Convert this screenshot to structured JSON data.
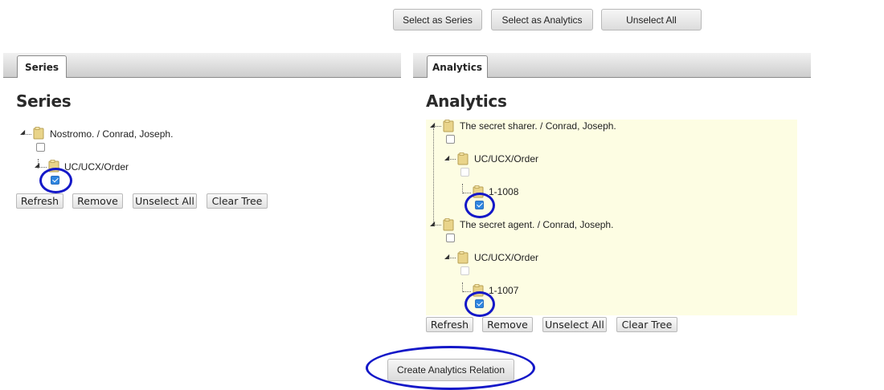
{
  "top_buttons": {
    "select_series": "Select as Series",
    "select_analytics": "Select as Analytics",
    "unselect_all": "Unselect All"
  },
  "series_panel": {
    "tab": "Series",
    "heading": "Series",
    "tree": {
      "root_label": "Nostromo. / Conrad, Joseph.",
      "child_label": "UC/UCX/Order",
      "child_checked": true
    },
    "buttons": {
      "refresh": "Refresh",
      "remove": "Remove",
      "unselect_all": "Unselect All",
      "clear_tree": "Clear Tree"
    }
  },
  "analytics_panel": {
    "tab": "Analytics",
    "heading": "Analytics",
    "tree": [
      {
        "root_label": "The secret sharer. / Conrad, Joseph.",
        "mid_label": "UC/UCX/Order",
        "leaf_label": "1-1008",
        "leaf_checked": true
      },
      {
        "root_label": "The secret agent. / Conrad, Joseph.",
        "mid_label": "UC/UCX/Order",
        "leaf_label": "1-1007",
        "leaf_checked": true
      }
    ],
    "buttons": {
      "refresh": "Refresh",
      "remove": "Remove",
      "unselect_all": "Unselect All",
      "clear_tree": "Clear Tree"
    }
  },
  "create_button": "Create Analytics Relation",
  "colors": {
    "highlight_ring": "#1418c8",
    "tree_background": "#fdfde3",
    "checkbox_checked": "#2f86e0"
  },
  "icons": [
    "folder-icon",
    "tree-toggle-icon",
    "checkbox"
  ]
}
